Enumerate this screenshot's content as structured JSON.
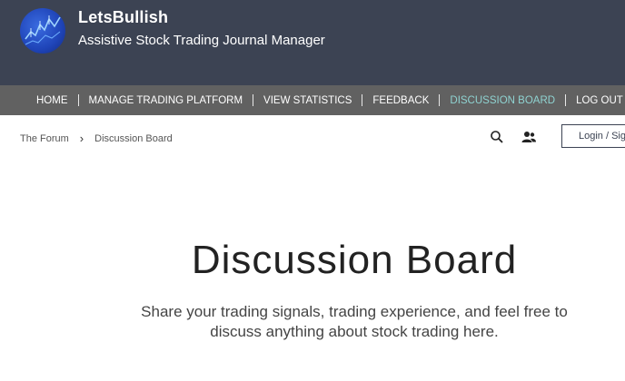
{
  "header": {
    "brand_name": "LetsBullish",
    "tagline": "Assistive Stock Trading Journal Manager",
    "logo_icon": "chart-logo-icon",
    "background": "#3c4353"
  },
  "nav": {
    "items": [
      {
        "label": "HOME"
      },
      {
        "label": "MANAGE TRADING PLATFORM"
      },
      {
        "label": "VIEW STATISTICS"
      },
      {
        "label": "FEEDBACK"
      },
      {
        "label": "DISCUSSION BOARD"
      },
      {
        "label": "LOG OUT"
      }
    ],
    "active_label": "DISCUSSION BOARD",
    "background": "#616161",
    "active_color": "#8fd3d1"
  },
  "breadcrumb": {
    "root": "The Forum",
    "separator": "›",
    "current": "Discussion Board"
  },
  "toolbar": {
    "search_icon": "search-icon",
    "members_icon": "members-icon",
    "login_label": "Login / Sign up"
  },
  "main": {
    "title": "Discussion Board",
    "subtitle_line1": "Share your trading signals, trading experience, and feel free to",
    "subtitle_line2": "discuss anything about stock trading here."
  }
}
